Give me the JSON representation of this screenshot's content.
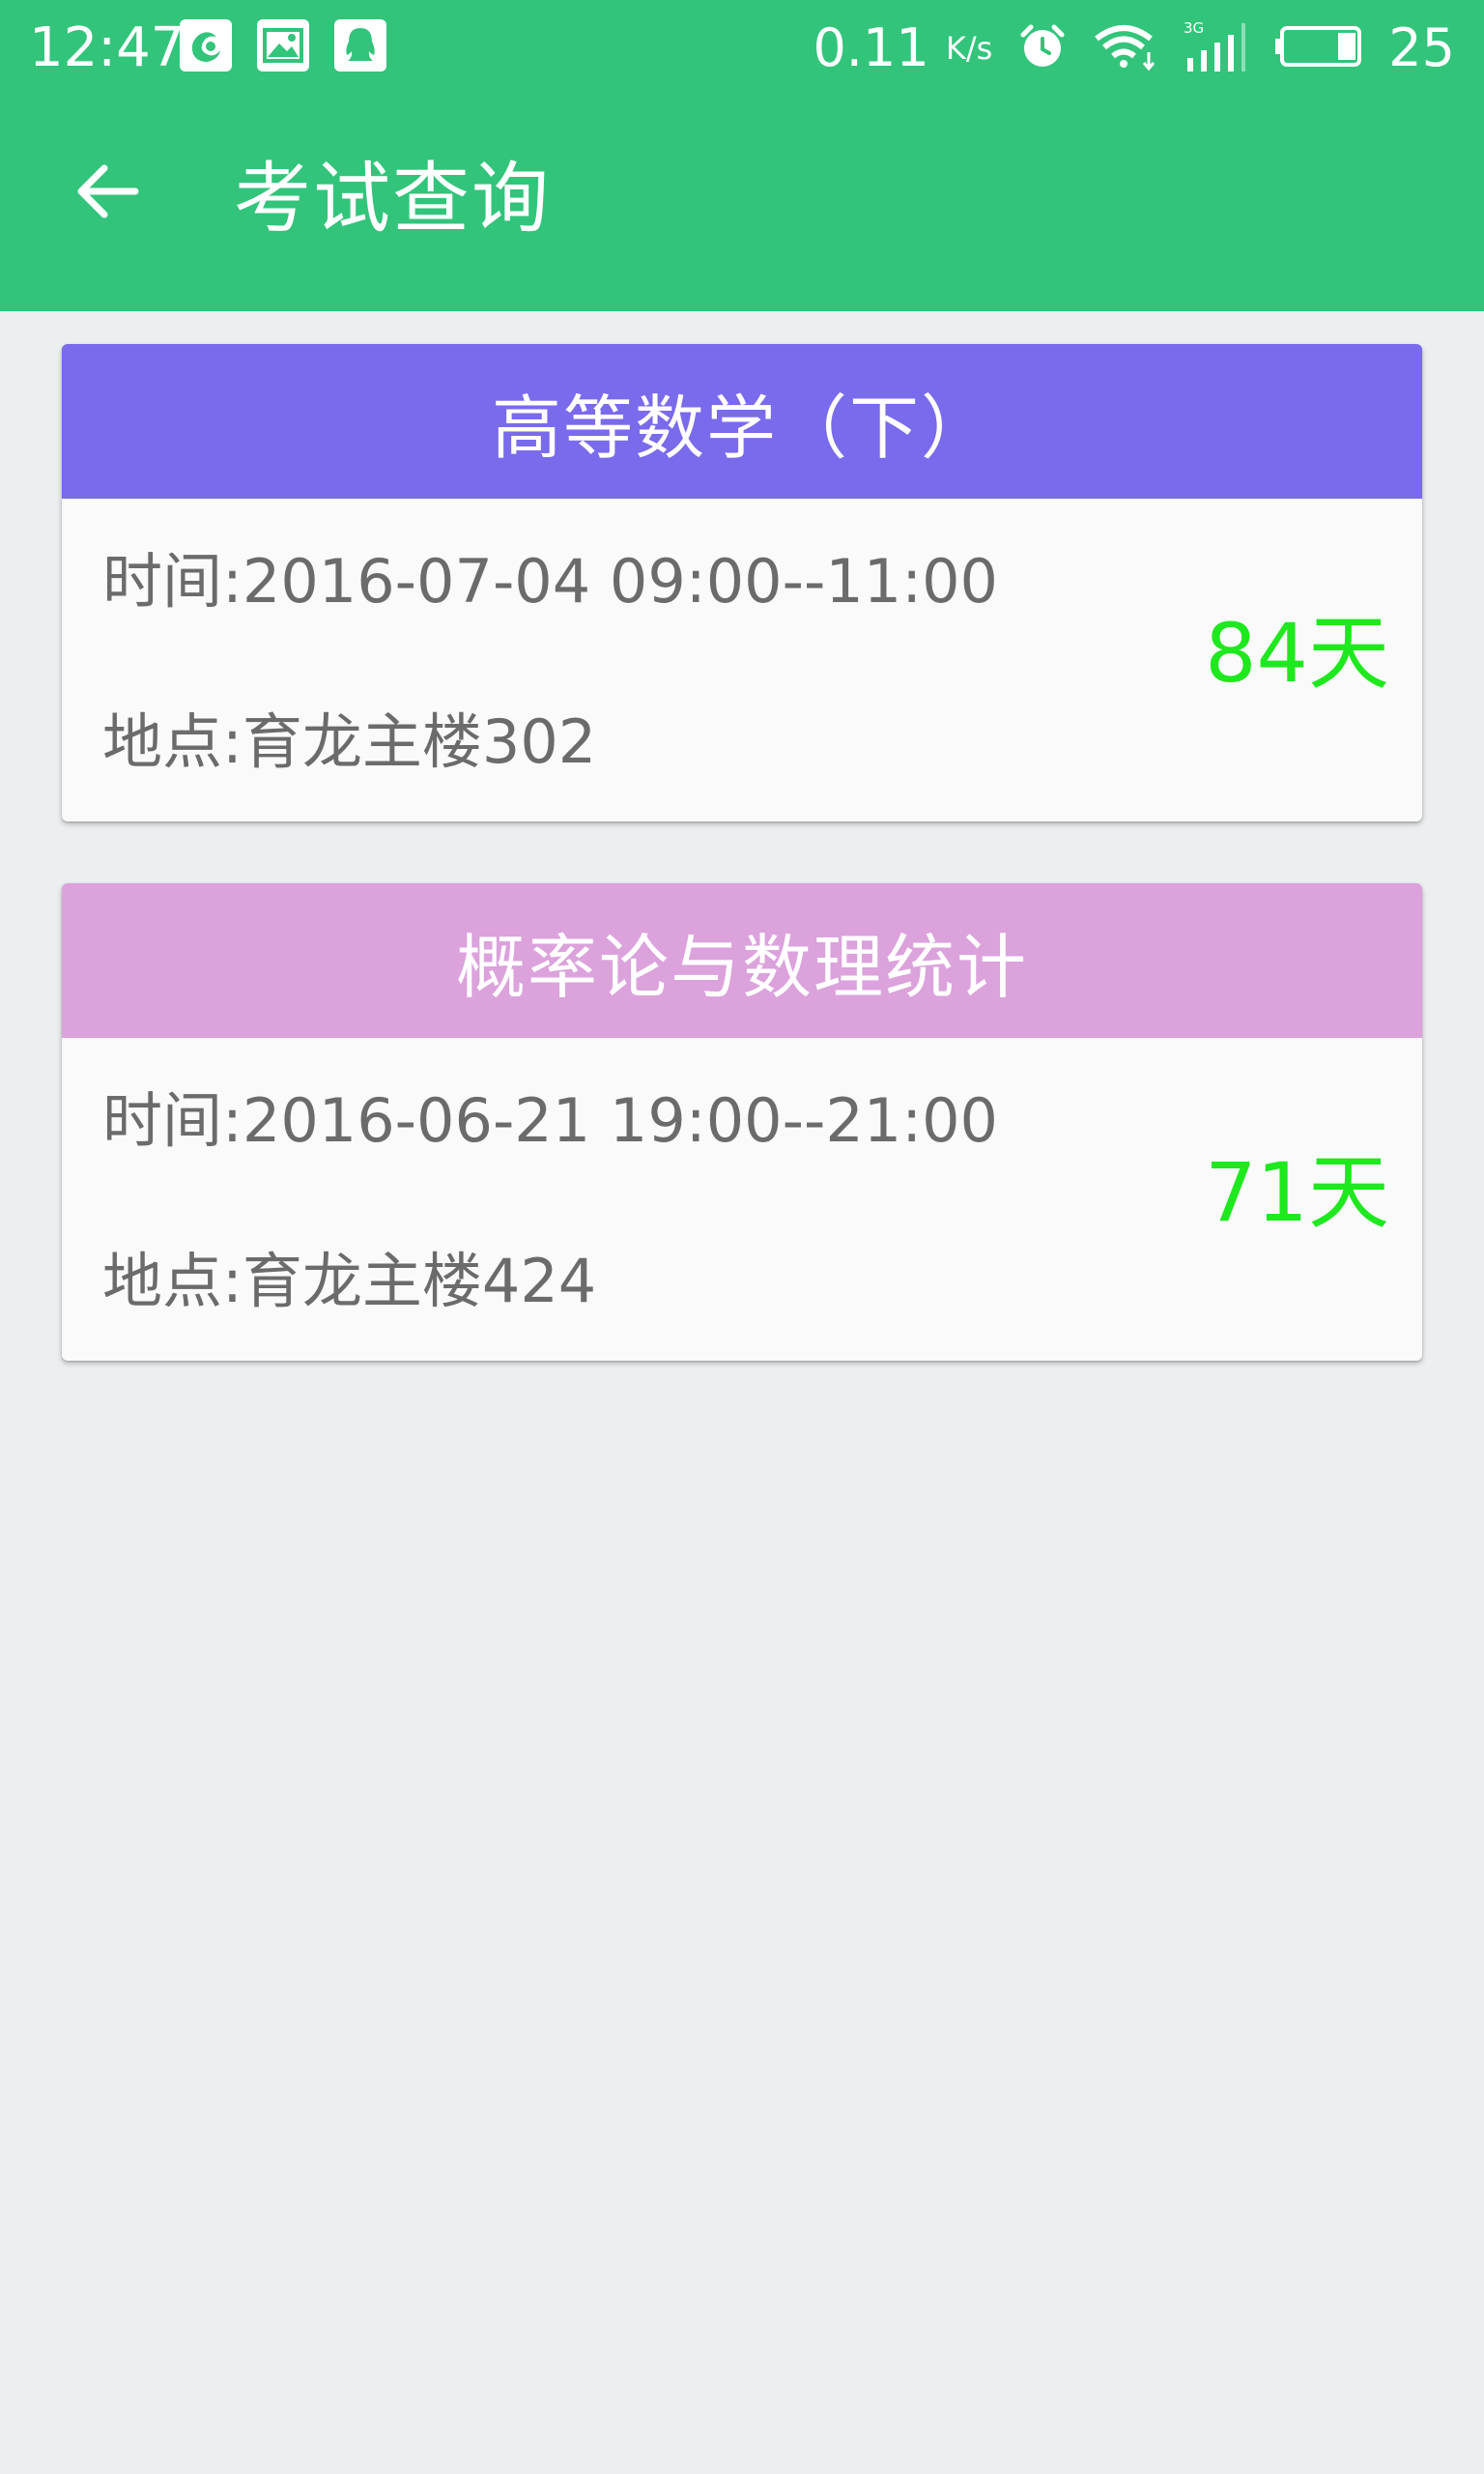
{
  "status_bar": {
    "time": "12:47",
    "speed_value": "0.11",
    "speed_unit": "K/s",
    "battery": "25",
    "icons": [
      "uc-browser-icon",
      "gallery-icon",
      "qq-icon",
      "alarm-icon",
      "wifi-icon",
      "signal-3g-icon",
      "battery-icon"
    ]
  },
  "toolbar": {
    "title": "考试查询",
    "back_icon": "arrow-left-icon"
  },
  "colors": {
    "appbar": "#32c47b",
    "background": "#ebeff0",
    "countdown": "#1ee81e"
  },
  "exams": [
    {
      "course": "高等数学（下）",
      "header_color": "#7a6aec",
      "time": "时间:2016-07-04 09:00--11:00",
      "place": "地点:育龙主楼302",
      "days_left": "84天"
    },
    {
      "course": "概率论与数理统计",
      "header_color": "#dba2dc",
      "time": "时间:2016-06-21 19:00--21:00",
      "place": "地点:育龙主楼424",
      "days_left": "71天"
    }
  ]
}
